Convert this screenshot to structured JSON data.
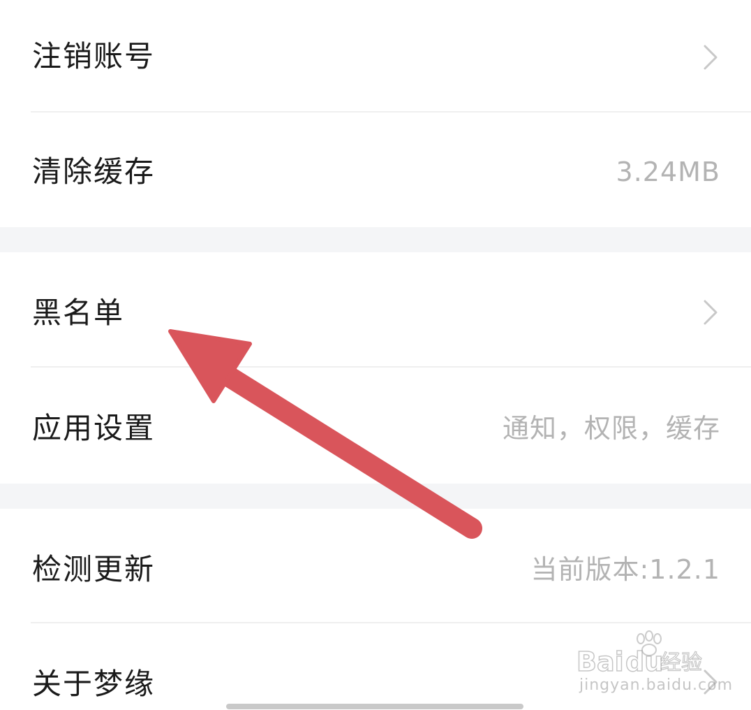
{
  "settings": {
    "items": [
      {
        "label": "注销账号",
        "value": "",
        "chevron": true
      },
      {
        "label": "清除缓存",
        "value": "3.24MB",
        "chevron": false
      },
      {
        "label": "黑名单",
        "value": "",
        "chevron": true
      },
      {
        "label": "应用设置",
        "value": "通知，权限，缓存",
        "chevron": false
      },
      {
        "label": "检测更新",
        "value": "当前版本:1.2.1",
        "chevron": false
      },
      {
        "label": "关于梦缘",
        "value": "",
        "chevron": true
      }
    ]
  },
  "watermark": {
    "brand": "Baidu经验",
    "url": "jingyan.baidu.com"
  },
  "annotation": {
    "arrow_color": "#d9555b",
    "points_to": "黑名单"
  },
  "colors": {
    "background": "#ffffff",
    "section_gap": "#f4f5f7",
    "label": "#1a1a1a",
    "value": "#b3b3b3",
    "chevron": "#c8c8c8"
  }
}
